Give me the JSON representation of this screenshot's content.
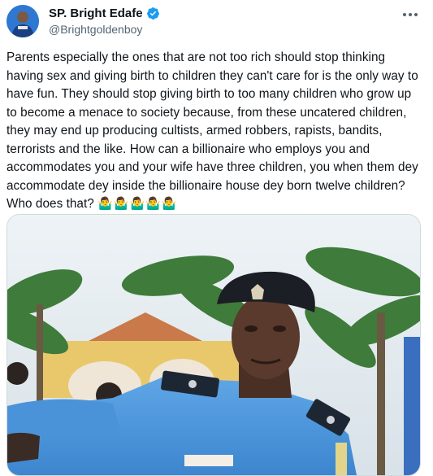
{
  "author": {
    "display_name": "SP. Bright Edafe",
    "handle": "@Brightgoldenboy",
    "avatar_icon": "avatar",
    "verified_icon": "verified-badge-icon",
    "verified_color": "#1d9bf0"
  },
  "tweet": {
    "text": "Parents especially the ones that are not too rich should stop thinking having sex and giving birth to children they can't care for is the only way to have fun. They should stop giving birth to too many children who grow up to become a menace to society because, from these uncatered children, they may end up producing cultists, armed robbers, rapists, bandits, terrorists and the like. How can a billionaire who employs you and accommodates you and your wife have three children, you when them dey accommodate dey inside the billionaire house dey born twelve children? Who does that?",
    "emojis": "🤷‍♂️🤷‍♂️🤷‍♂️🤷‍♂️🤷‍♂️"
  },
  "media": {
    "icon": "police-officer-photo"
  },
  "actions": {
    "more_icon": "more-options-icon"
  }
}
